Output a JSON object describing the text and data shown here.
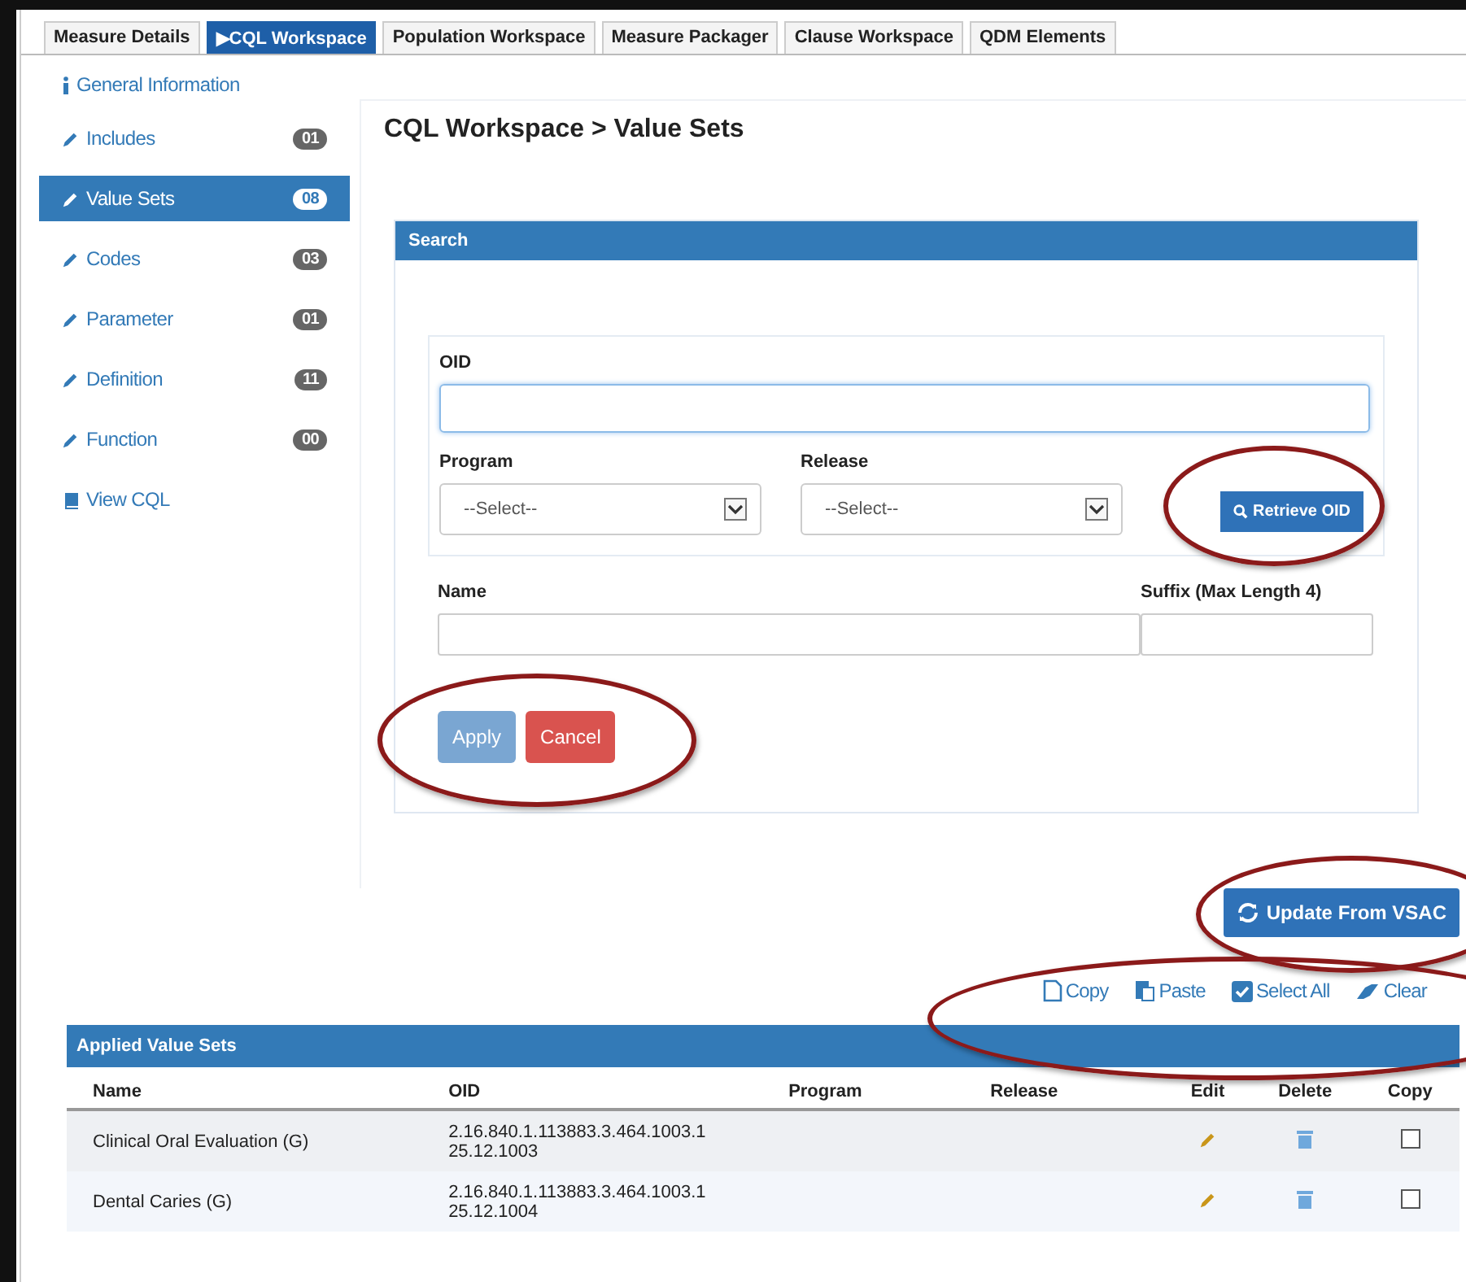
{
  "tabs": [
    {
      "label": "Measure Details",
      "selected": false
    },
    {
      "label": "CQL Workspace",
      "selected": true
    },
    {
      "label": "Population Workspace",
      "selected": false
    },
    {
      "label": "Measure Packager",
      "selected": false
    },
    {
      "label": "Clause Workspace",
      "selected": false
    },
    {
      "label": "QDM Elements",
      "selected": false
    }
  ],
  "tab_marker": "▶",
  "sidebar": {
    "items": [
      {
        "kind": "info",
        "label": "General Information",
        "selected": false
      },
      {
        "kind": "edit",
        "label": "Includes",
        "count": "01",
        "selected": false
      },
      {
        "kind": "edit",
        "label": "Value Sets",
        "count": "08",
        "selected": true
      },
      {
        "kind": "edit",
        "label": "Codes",
        "count": "03",
        "selected": false
      },
      {
        "kind": "edit",
        "label": "Parameter",
        "count": "01",
        "selected": false
      },
      {
        "kind": "edit",
        "label": "Definition",
        "count": "11",
        "selected": false
      },
      {
        "kind": "edit",
        "label": "Function",
        "count": "00",
        "selected": false
      },
      {
        "kind": "book",
        "label": "View CQL",
        "selected": false
      }
    ]
  },
  "heading": "CQL Workspace > Value Sets",
  "search": {
    "title": "Search",
    "oid_label": "OID",
    "program_label": "Program",
    "program_value": "--Select--",
    "release_label": "Release",
    "release_value": "--Select--",
    "retrieve_button": "Retrieve OID",
    "name_label": "Name",
    "suffix_label": "Suffix (Max Length 4)",
    "apply_button": "Apply",
    "cancel_button": "Cancel"
  },
  "update_button": "Update From VSAC",
  "toolbar": [
    {
      "kind": "copy",
      "label": "Copy"
    },
    {
      "kind": "paste",
      "label": "Paste"
    },
    {
      "kind": "select",
      "label": "Select All"
    },
    {
      "kind": "clear",
      "label": "Clear"
    }
  ],
  "table": {
    "title": "Applied Value Sets",
    "columns": [
      "Name",
      "OID",
      "Program",
      "Release",
      "Edit",
      "Delete",
      "Copy"
    ],
    "rows": [
      {
        "name": "Clinical Oral Evaluation (G)",
        "oid": [
          "2.16.840.1.113883.3.464.1003.1",
          "25.12.1003"
        ],
        "checked": false
      },
      {
        "name": "Dental Caries (G)",
        "oid": [
          "2.16.840.1.113883.3.464.1003.1",
          "25.12.1004"
        ],
        "checked": false
      }
    ]
  }
}
